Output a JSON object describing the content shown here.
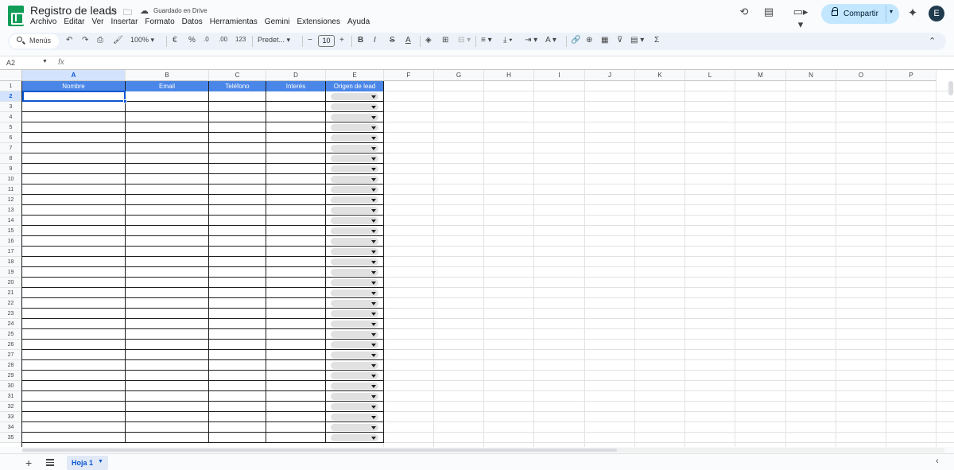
{
  "app": {
    "doc_title": "Registro de leads",
    "saved_status": "Guardado en Drive",
    "menu": [
      "Archivo",
      "Editar",
      "Ver",
      "Insertar",
      "Formato",
      "Datos",
      "Herramientas",
      "Gemini",
      "Extensiones",
      "Ayuda"
    ],
    "share_label": "Compartir",
    "avatar_letter": "E"
  },
  "toolbar": {
    "search_label": "Menús",
    "zoom": "100%",
    "currency": "€",
    "percent": "%",
    "dec_decrease": ".0",
    "dec_increase": ".00",
    "number_format": "123",
    "font_name": "Predet...",
    "font_size": "10",
    "bold": "B",
    "italic": "I",
    "strike": "S",
    "text_color": "A",
    "sum": "Σ",
    "minus": "−",
    "plus": "+"
  },
  "formula_bar": {
    "name_box": "A2",
    "fx": "fx",
    "value": ""
  },
  "sheet": {
    "columns": [
      "A",
      "B",
      "C",
      "D",
      "E",
      "F",
      "G",
      "H",
      "I",
      "J",
      "K",
      "L",
      "M",
      "N",
      "O",
      "P"
    ],
    "selected_column": "A",
    "rows": [
      "1",
      "2",
      "3",
      "4",
      "5",
      "6",
      "7",
      "8",
      "9",
      "10",
      "11",
      "12",
      "13",
      "14",
      "15",
      "16",
      "17",
      "18",
      "19",
      "20",
      "21",
      "22",
      "23",
      "24",
      "25",
      "26",
      "27",
      "28",
      "29",
      "30",
      "31",
      "32",
      "33",
      "34",
      "35"
    ],
    "selected_row": "2",
    "headers": [
      "Nombre",
      "Email",
      "Teléfono",
      "Interés",
      "Origen de lead"
    ],
    "header_color": "#4a86e8",
    "selection_color": "#0b57d0"
  },
  "tabs": {
    "sheet_name": "Hoja 1"
  }
}
